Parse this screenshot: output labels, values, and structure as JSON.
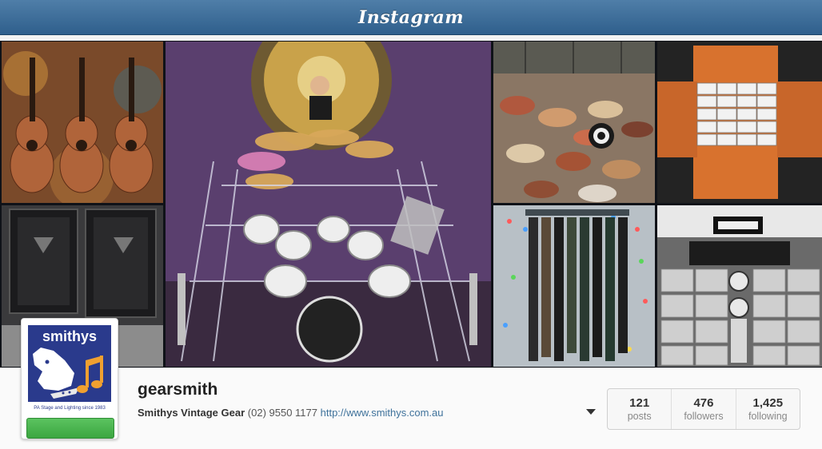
{
  "app": {
    "logo_text": "Instagram"
  },
  "colors": {
    "header": "#3f6f9a",
    "link": "#3f729b",
    "follow": "#4cb651"
  },
  "collage": {
    "tiles": [
      {
        "name": "ukuleles-photo"
      },
      {
        "name": "drum-kit-photo"
      },
      {
        "name": "guitar-pile-photo"
      },
      {
        "name": "pioneer-boxes-photo"
      },
      {
        "name": "speaker-cabinets-photo"
      },
      {
        "name": "guitar-straps-photo"
      },
      {
        "name": "pioneer-hifi-wall-photo"
      }
    ]
  },
  "profile": {
    "avatar_brand": "smithys",
    "avatar_tagline": "PA Stage and Lighting since 1983",
    "username": "gearsmith",
    "full_name": "Smithys Vintage Gear",
    "phone": "(02) 9550 1177",
    "website": "http://www.smithys.com.au"
  },
  "stats": [
    {
      "count": "121",
      "label": "posts"
    },
    {
      "count": "476",
      "label": "followers"
    },
    {
      "count": "1,425",
      "label": "following"
    }
  ]
}
